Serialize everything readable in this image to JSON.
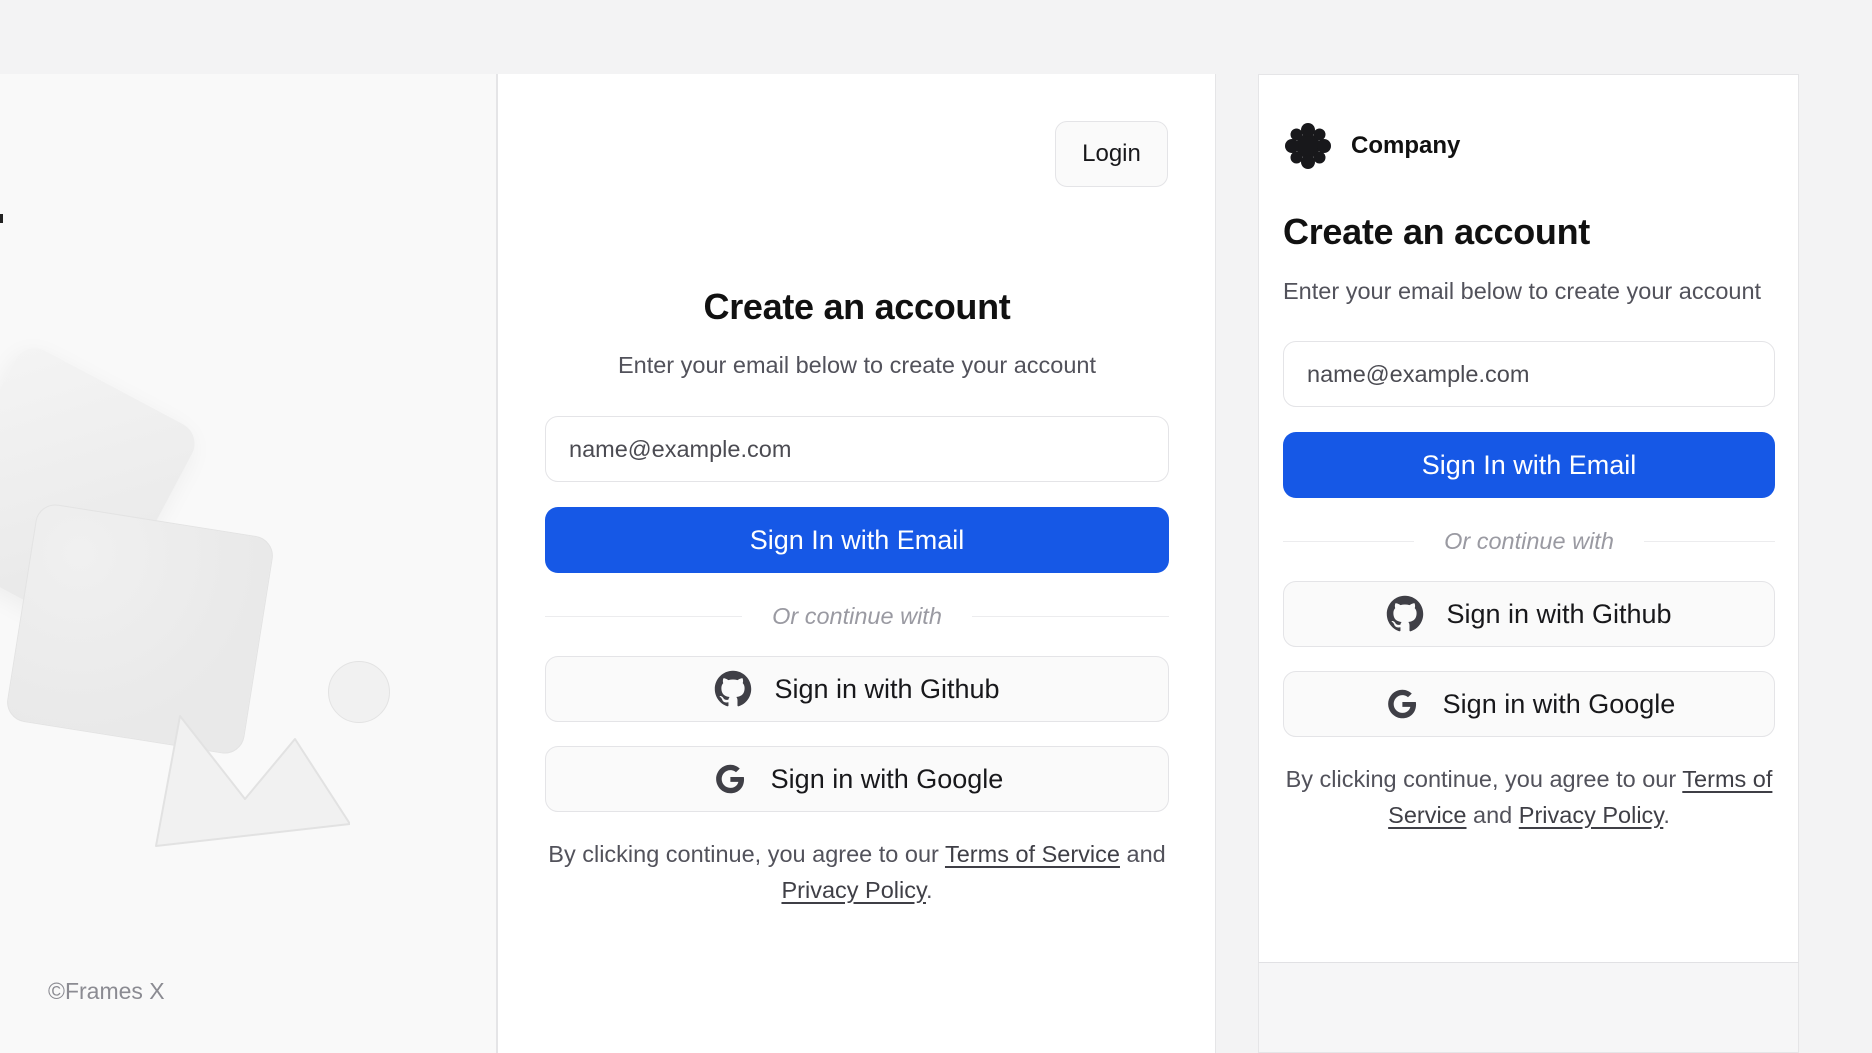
{
  "footer": {
    "copyright": "©Frames X"
  },
  "center": {
    "login_label": "Login",
    "title": "Create an account",
    "subtitle": "Enter your email below to create your account",
    "email_placeholder": "name@example.com",
    "email_button": "Sign In with Email",
    "divider_text": "Or continue with",
    "github_button": "Sign in with Github",
    "google_button": "Sign in with Google",
    "legal_prefix": "By clicking continue, you agree to our",
    "terms_link": "Terms of Service",
    "legal_and": "and",
    "privacy_link": "Privacy Policy",
    "legal_suffix": "."
  },
  "right": {
    "brand_name": "Company",
    "title": "Create an account",
    "subtitle": "Enter your email below to create your account",
    "email_placeholder": "name@example.com",
    "email_button": "Sign In with Email",
    "divider_text": "Or continue with",
    "github_button": "Sign in with Github",
    "google_button": "Sign in with Google",
    "legal_prefix": "By clicking continue, you agree to our",
    "terms_link": "Terms of Service",
    "legal_and": "and",
    "privacy_link": "Privacy Policy",
    "legal_suffix": "."
  },
  "icons": {
    "brand": "company-logo-icon",
    "github": "github-icon",
    "google": "google-icon"
  },
  "colors": {
    "primary": "#1658e6",
    "background": "#f3f3f4",
    "card": "#ffffff",
    "muted_text": "#52525b"
  }
}
